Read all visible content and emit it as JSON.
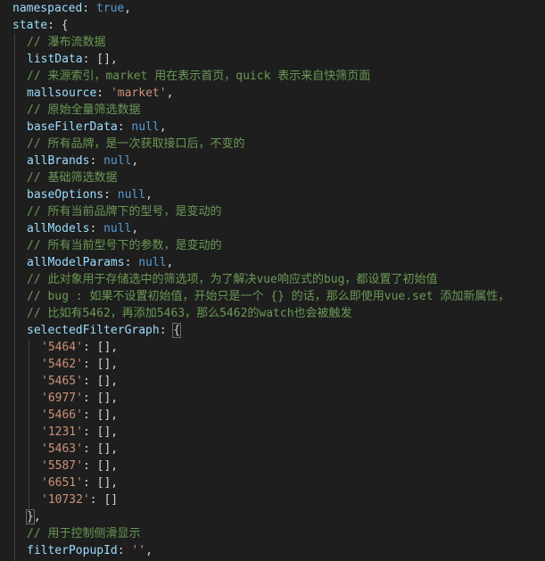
{
  "lines": [
    {
      "indent": 0,
      "tokens": [
        {
          "t": "key",
          "v": "namespaced"
        },
        {
          "t": "punct",
          "v": ": "
        },
        {
          "t": "kw",
          "v": "true"
        },
        {
          "t": "punct",
          "v": ","
        }
      ]
    },
    {
      "indent": 0,
      "tokens": [
        {
          "t": "key",
          "v": "state"
        },
        {
          "t": "punct",
          "v": ": {"
        }
      ]
    },
    {
      "indent": 1,
      "tokens": [
        {
          "t": "comment",
          "v": "// 瀑布流数据"
        }
      ]
    },
    {
      "indent": 1,
      "tokens": [
        {
          "t": "key",
          "v": "listData"
        },
        {
          "t": "punct",
          "v": ": [],"
        }
      ]
    },
    {
      "indent": 1,
      "tokens": [
        {
          "t": "comment",
          "v": "// 来源索引，market 用在表示首页，quick 表示来自快筛页面"
        }
      ]
    },
    {
      "indent": 1,
      "tokens": [
        {
          "t": "key",
          "v": "mallsource"
        },
        {
          "t": "punct",
          "v": ": "
        },
        {
          "t": "str",
          "v": "'market'"
        },
        {
          "t": "punct",
          "v": ","
        }
      ]
    },
    {
      "indent": 1,
      "tokens": [
        {
          "t": "comment",
          "v": "// 原始全量筛选数据"
        }
      ]
    },
    {
      "indent": 1,
      "tokens": [
        {
          "t": "key",
          "v": "baseFilerData"
        },
        {
          "t": "punct",
          "v": ": "
        },
        {
          "t": "kw",
          "v": "null"
        },
        {
          "t": "punct",
          "v": ","
        }
      ]
    },
    {
      "indent": 1,
      "tokens": [
        {
          "t": "comment",
          "v": "// 所有品牌，是一次获取接口后，不变的"
        }
      ]
    },
    {
      "indent": 1,
      "tokens": [
        {
          "t": "key",
          "v": "allBrands"
        },
        {
          "t": "punct",
          "v": ": "
        },
        {
          "t": "kw",
          "v": "null"
        },
        {
          "t": "punct",
          "v": ","
        }
      ]
    },
    {
      "indent": 1,
      "tokens": [
        {
          "t": "comment",
          "v": "// 基础筛选数据"
        }
      ]
    },
    {
      "indent": 1,
      "tokens": [
        {
          "t": "key",
          "v": "baseOptions"
        },
        {
          "t": "punct",
          "v": ": "
        },
        {
          "t": "kw",
          "v": "null"
        },
        {
          "t": "punct",
          "v": ","
        }
      ]
    },
    {
      "indent": 1,
      "tokens": [
        {
          "t": "comment",
          "v": "// 所有当前品牌下的型号，是变动的"
        }
      ]
    },
    {
      "indent": 1,
      "tokens": [
        {
          "t": "key",
          "v": "allModels"
        },
        {
          "t": "punct",
          "v": ": "
        },
        {
          "t": "kw",
          "v": "null"
        },
        {
          "t": "punct",
          "v": ","
        }
      ]
    },
    {
      "indent": 1,
      "tokens": [
        {
          "t": "comment",
          "v": "// 所有当前型号下的参数，是变动的"
        }
      ]
    },
    {
      "indent": 1,
      "tokens": [
        {
          "t": "key",
          "v": "allModelParams"
        },
        {
          "t": "punct",
          "v": ": "
        },
        {
          "t": "kw",
          "v": "null"
        },
        {
          "t": "punct",
          "v": ","
        }
      ]
    },
    {
      "indent": 1,
      "tokens": [
        {
          "t": "comment",
          "v": "// 此对象用于存储选中的筛选项，为了解决vue响应式的bug，都设置了初始值"
        }
      ]
    },
    {
      "indent": 1,
      "tokens": [
        {
          "t": "comment",
          "v": "// bug : 如果不设置初始值，开始只是一个 {} 的话，那么即使用vue.set 添加新属性，"
        }
      ]
    },
    {
      "indent": 1,
      "tokens": [
        {
          "t": "comment",
          "v": "// 比如有5462，再添加5463，那么5462的watch也会被触发"
        }
      ]
    },
    {
      "indent": 1,
      "tokens": [
        {
          "t": "key",
          "v": "selectedFilterGraph"
        },
        {
          "t": "punct",
          "v": ": "
        },
        {
          "t": "brace",
          "v": "{"
        }
      ]
    },
    {
      "indent": 2,
      "tokens": [
        {
          "t": "str",
          "v": "'5464'"
        },
        {
          "t": "punct",
          "v": ": [],"
        }
      ]
    },
    {
      "indent": 2,
      "tokens": [
        {
          "t": "str",
          "v": "'5462'"
        },
        {
          "t": "punct",
          "v": ": [],"
        }
      ]
    },
    {
      "indent": 2,
      "tokens": [
        {
          "t": "str",
          "v": "'5465'"
        },
        {
          "t": "punct",
          "v": ": [],"
        }
      ]
    },
    {
      "indent": 2,
      "tokens": [
        {
          "t": "str",
          "v": "'6977'"
        },
        {
          "t": "punct",
          "v": ": [],"
        }
      ]
    },
    {
      "indent": 2,
      "tokens": [
        {
          "t": "str",
          "v": "'5466'"
        },
        {
          "t": "punct",
          "v": ": [],"
        }
      ]
    },
    {
      "indent": 2,
      "tokens": [
        {
          "t": "str",
          "v": "'1231'"
        },
        {
          "t": "punct",
          "v": ": [],"
        }
      ]
    },
    {
      "indent": 2,
      "tokens": [
        {
          "t": "str",
          "v": "'5463'"
        },
        {
          "t": "punct",
          "v": ": [],"
        }
      ]
    },
    {
      "indent": 2,
      "tokens": [
        {
          "t": "str",
          "v": "'5587'"
        },
        {
          "t": "punct",
          "v": ": [],"
        }
      ]
    },
    {
      "indent": 2,
      "tokens": [
        {
          "t": "str",
          "v": "'6651'"
        },
        {
          "t": "punct",
          "v": ": [],"
        }
      ]
    },
    {
      "indent": 2,
      "tokens": [
        {
          "t": "str",
          "v": "'10732'"
        },
        {
          "t": "punct",
          "v": ": []"
        }
      ]
    },
    {
      "indent": 1,
      "tokens": [
        {
          "t": "brace",
          "v": "}"
        },
        {
          "t": "punct",
          "v": ","
        }
      ]
    },
    {
      "indent": 1,
      "tokens": [
        {
          "t": "comment",
          "v": "// 用于控制侧滑显示"
        }
      ]
    },
    {
      "indent": 1,
      "tokens": [
        {
          "t": "key",
          "v": "filterPopupId"
        },
        {
          "t": "punct",
          "v": ": "
        },
        {
          "t": "str",
          "v": "''"
        },
        {
          "t": "punct",
          "v": ","
        }
      ]
    }
  ]
}
